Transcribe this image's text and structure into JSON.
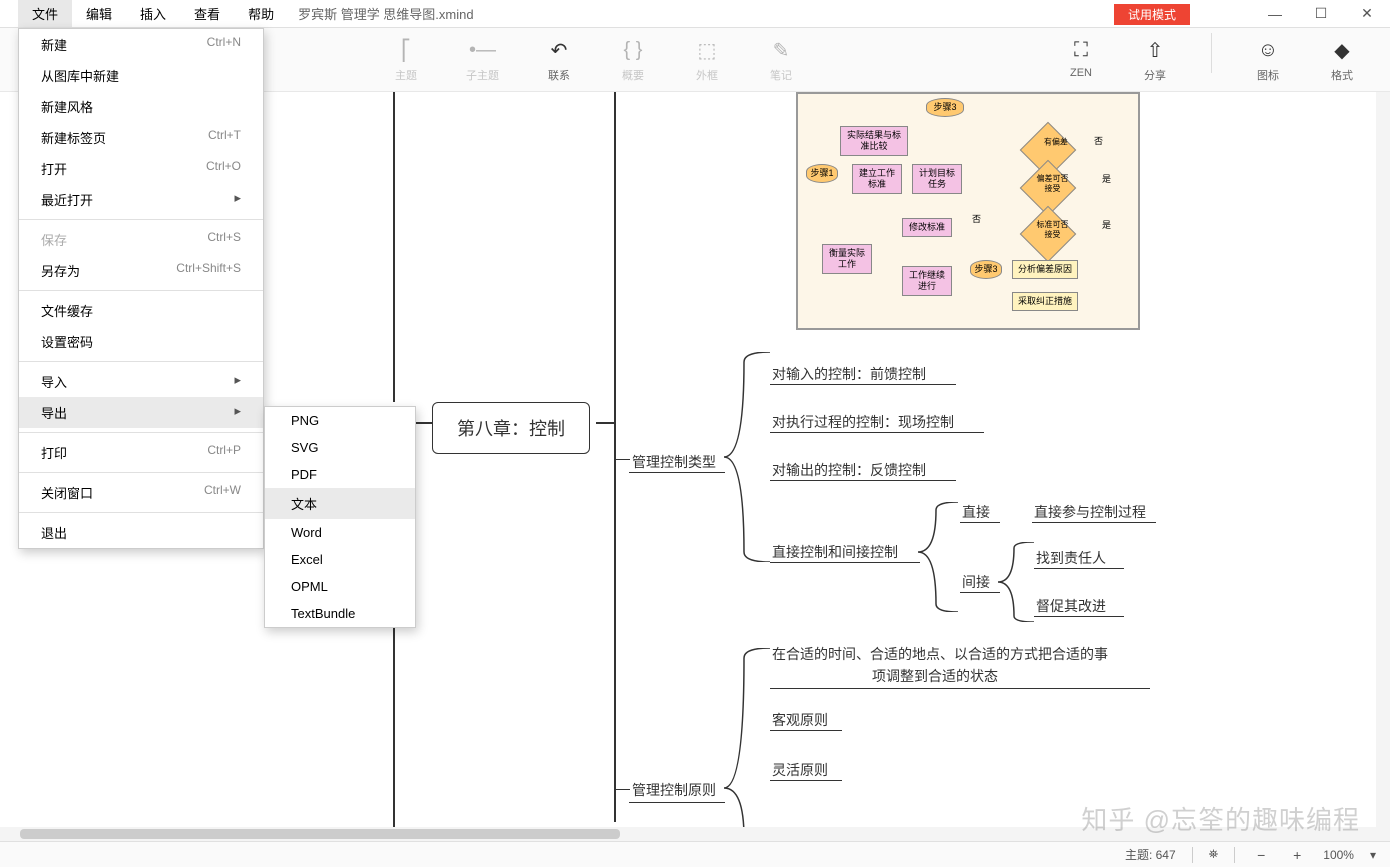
{
  "titlebar": {
    "menus": [
      "文件",
      "编辑",
      "插入",
      "查看",
      "帮助"
    ],
    "doc_title": "罗宾斯 管理学 思维导图.xmind",
    "trial_label": "试用模式",
    "win_min": "—",
    "win_max": "☐",
    "win_close": "✕"
  },
  "toolbar": {
    "items": [
      {
        "icon": "⎡",
        "label": "主题"
      },
      {
        "icon": "•—",
        "label": "子主题"
      },
      {
        "icon": "↶",
        "label": "联系"
      },
      {
        "icon": "{ }",
        "label": "概要"
      },
      {
        "icon": "⬚",
        "label": "外框"
      },
      {
        "icon": "✎",
        "label": "笔记"
      }
    ],
    "zen": {
      "icon": "⛶",
      "label": "ZEN"
    },
    "share": {
      "icon": "⇧",
      "label": "分享"
    },
    "icons": {
      "icon": "☺",
      "label": "图标"
    },
    "format": {
      "icon": "◆",
      "label": "格式"
    }
  },
  "dropdown": {
    "items": [
      {
        "label": "新建",
        "shortcut": "Ctrl+N"
      },
      {
        "label": "从图库中新建",
        "shortcut": ""
      },
      {
        "label": "新建风格",
        "shortcut": ""
      },
      {
        "label": "新建标签页",
        "shortcut": "Ctrl+T"
      },
      {
        "label": "打开",
        "shortcut": "Ctrl+O"
      },
      {
        "label": "最近打开",
        "shortcut": "",
        "arrow": true
      },
      {
        "sep": true
      },
      {
        "label": "保存",
        "shortcut": "Ctrl+S",
        "disabled": true
      },
      {
        "label": "另存为",
        "shortcut": "Ctrl+Shift+S"
      },
      {
        "sep": true
      },
      {
        "label": "文件缓存",
        "shortcut": ""
      },
      {
        "label": "设置密码",
        "shortcut": ""
      },
      {
        "sep": true
      },
      {
        "label": "导入",
        "shortcut": "",
        "arrow": true
      },
      {
        "label": "导出",
        "shortcut": "",
        "arrow": true,
        "highlighted": true
      },
      {
        "sep": true
      },
      {
        "label": "打印",
        "shortcut": "Ctrl+P"
      },
      {
        "sep": true
      },
      {
        "label": "关闭窗口",
        "shortcut": "Ctrl+W"
      },
      {
        "sep": true
      },
      {
        "label": "退出",
        "shortcut": ""
      }
    ]
  },
  "submenu": {
    "items": [
      "PNG",
      "SVG",
      "PDF",
      "文本",
      "Word",
      "Excel",
      "OPML",
      "TextBundle"
    ],
    "highlighted_index": 3
  },
  "mindmap": {
    "central": "第八章：控制",
    "branch_type": "管理控制类型",
    "branch_principle": "管理控制原则",
    "type_items": [
      "对输入的控制：前馈控制",
      "对执行过程的控制：现场控制",
      "对输出的控制：反馈控制",
      "直接控制和间接控制"
    ],
    "direct_indirect": {
      "direct": "直接",
      "indirect": "间接",
      "direct_desc": "直接参与控制过程",
      "indirect1": "找到责任人",
      "indirect2": "督促其改进"
    },
    "principle_lead": "在合适的时间、合适的地点、以合适的方式把合适的事",
    "principle_lead2": "项调整到合适的状态",
    "principle_items": [
      "客观原则",
      "灵活原则"
    ]
  },
  "flowchart": {
    "step1": "步骤1",
    "step3": "步骤3",
    "step3b": "步骤3",
    "box1": "实际结果与标准比较",
    "box2": "建立工作标准",
    "box3": "计划目标任务",
    "box4": "衡量实际工作",
    "box5": "修改标准",
    "box6": "工作继续进行",
    "d1": "有偏差",
    "d2": "偏差可否接受",
    "d3": "标准可否接受",
    "box7": "分析偏差原因",
    "box8": "采取纠正措施",
    "yes": "是",
    "no": "否"
  },
  "statusbar": {
    "topic_label": "主题:",
    "topic_count": "647",
    "zoom": "100%"
  },
  "watermark": "知乎 @忘筌的趣味编程"
}
